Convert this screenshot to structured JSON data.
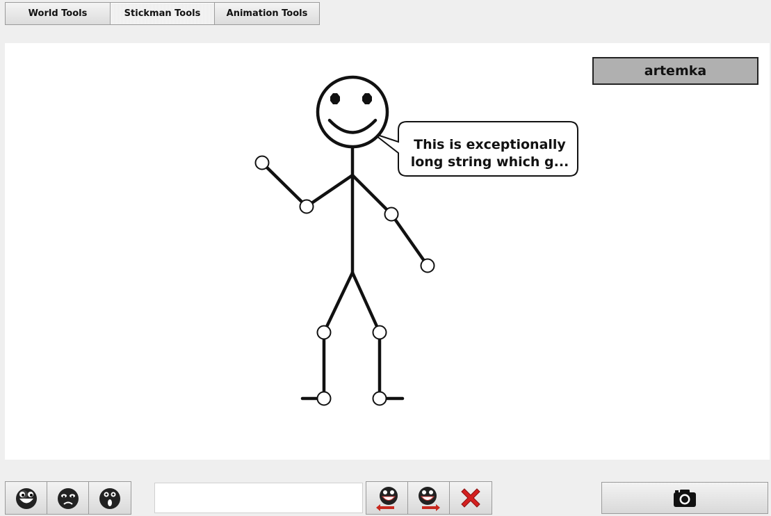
{
  "tabs": [
    {
      "label": "World Tools",
      "active": false
    },
    {
      "label": "Stickman Tools",
      "active": true
    },
    {
      "label": "Animation Tools",
      "active": false
    }
  ],
  "canvas": {
    "name_badge": "artemka",
    "speech_bubble": {
      "line1": "This is exceptionally",
      "line2": "long string which g..."
    }
  },
  "bottom_toolbar": {
    "emotion_buttons": [
      {
        "icon": "happy-face-icon"
      },
      {
        "icon": "sad-face-icon"
      },
      {
        "icon": "surprised-face-icon"
      }
    ],
    "text_input": {
      "value": "",
      "placeholder": ""
    },
    "action_buttons": [
      {
        "icon": "turn-left-icon"
      },
      {
        "icon": "turn-right-icon"
      },
      {
        "icon": "delete-x-icon"
      }
    ],
    "snapshot_button": {
      "icon": "camera-icon"
    }
  },
  "colors": {
    "background": "#efefef",
    "canvas": "#ffffff",
    "badge": "#b0b0b0",
    "delete": "#d42020",
    "arrow": "#c8281e"
  }
}
